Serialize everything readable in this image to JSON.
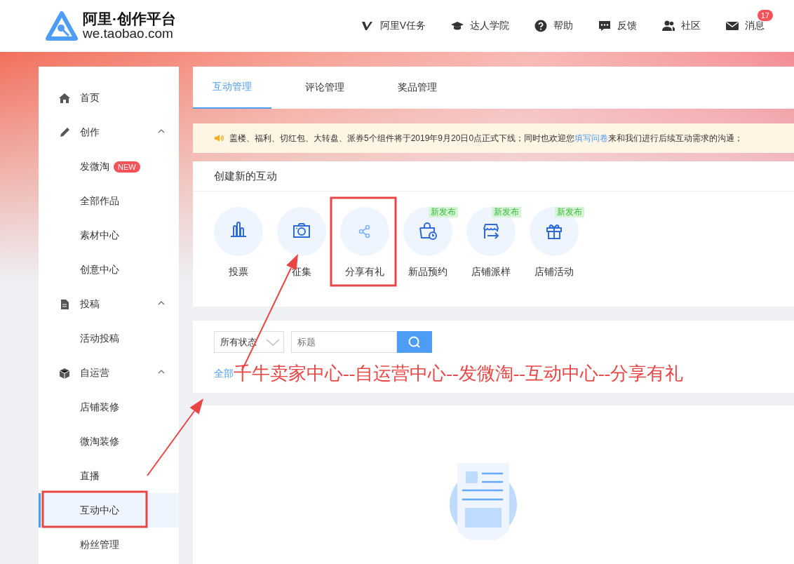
{
  "header": {
    "logo_title": "阿里·创作平台",
    "logo_subtitle": "we.taobao.com",
    "nav": [
      {
        "kind": "v",
        "label": "阿里V任务"
      },
      {
        "kind": "cap",
        "label": "达人学院"
      },
      {
        "kind": "help",
        "label": "帮助"
      },
      {
        "kind": "chat",
        "label": "反馈"
      },
      {
        "kind": "people",
        "label": "社区"
      },
      {
        "kind": "mail",
        "label": "消息",
        "badge": "17"
      }
    ]
  },
  "sidebar": {
    "items": [
      {
        "kind": "home",
        "label": "首页",
        "selected": false
      },
      {
        "kind": "pen",
        "label": "创作",
        "expanded": true,
        "children": [
          {
            "label": "发微淘",
            "badge": "NEW",
            "selected": false
          },
          {
            "label": "全部作品",
            "selected": false
          },
          {
            "label": "素材中心",
            "selected": false
          },
          {
            "label": "创意中心",
            "selected": false
          }
        ]
      },
      {
        "kind": "doc",
        "label": "投稿",
        "expanded": true,
        "children": [
          {
            "label": "活动投稿",
            "selected": false
          }
        ]
      },
      {
        "kind": "box",
        "label": "自运营",
        "expanded": true,
        "children": [
          {
            "label": "店铺装修",
            "selected": false
          },
          {
            "label": "微淘装修",
            "selected": false
          },
          {
            "label": "直播",
            "selected": false
          },
          {
            "label": "互动中心",
            "selected": true
          },
          {
            "label": "粉丝管理",
            "selected": false
          }
        ]
      }
    ]
  },
  "tabs": [
    {
      "label": "互动管理",
      "selected": true
    },
    {
      "label": "评论管理",
      "selected": false
    },
    {
      "label": "奖品管理",
      "selected": false
    }
  ],
  "notice": {
    "text_before": "盖楼、福利、切红包、大转盘、派券5个组件将于2019年9月20日0点正式下线；同时也欢迎您",
    "link": "填写问卷",
    "text_after": "来和我们进行后续互动需求的沟通；"
  },
  "create": {
    "title": "创建新的互动",
    "items": [
      {
        "kind": "vote",
        "label": "投票",
        "hovered": false
      },
      {
        "kind": "camera",
        "label": "征集",
        "hovered": false
      },
      {
        "kind": "share",
        "label": "分享有礼",
        "hovered": true
      },
      {
        "kind": "bag",
        "label": "新品预约",
        "badge": "新发布",
        "hovered": false
      },
      {
        "kind": "store",
        "label": "店铺派样",
        "badge": "新发布",
        "hovered": false
      },
      {
        "kind": "gift",
        "label": "店铺活动",
        "badge": "新发布",
        "hovered": false
      }
    ]
  },
  "filter": {
    "status": "所有状态",
    "search_placeholder": "标题",
    "category": "全部"
  },
  "annotation": {
    "caption": "千牛卖家中心--自运营中心--发微淘--互动中心--分享有礼"
  }
}
